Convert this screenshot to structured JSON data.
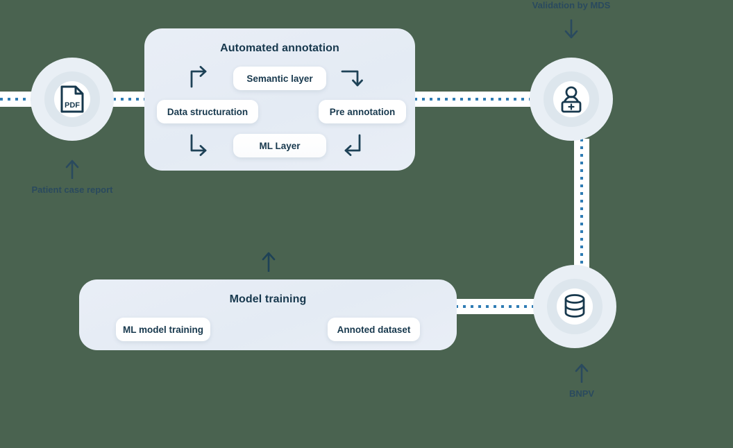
{
  "colors": {
    "background": "#4a6350",
    "card_bg": "#e8eef6",
    "node_outer": "#e9eff5",
    "node_mid": "#dde6ed",
    "node_inner": "#ffffff",
    "ink": "#17384d",
    "label_ink": "#2a4a5e",
    "dot_blue": "#2f7cb4"
  },
  "nodes": {
    "pdf": {
      "icon": "pdf-document-icon",
      "icon_text": "PDF",
      "label": "Patient case report",
      "arrow": "arrow-up-icon"
    },
    "validator": {
      "icon": "medical-professional-icon",
      "label": "Validation by MDS",
      "arrow": "arrow-down-icon"
    },
    "database": {
      "icon": "database-icon",
      "label": "BNPV",
      "arrow": "arrow-up-icon"
    }
  },
  "cards": {
    "annotation": {
      "title": "Automated annotation",
      "pills": [
        {
          "label": "Semantic layer"
        },
        {
          "label": "Data structuration"
        },
        {
          "label": "Pre annotation"
        },
        {
          "label": "ML Layer"
        }
      ],
      "arrows": [
        {
          "name": "elbow-arrow-up-right-icon"
        },
        {
          "name": "elbow-arrow-right-down-icon"
        },
        {
          "name": "elbow-arrow-down-right-icon"
        },
        {
          "name": "elbow-arrow-down-left-icon"
        }
      ]
    },
    "training": {
      "title": "Model training",
      "pills": [
        {
          "label": "ML model training"
        },
        {
          "label": "Annoted dataset"
        }
      ]
    }
  },
  "flow": {
    "arrow_up_between_cards": "arrow-up-icon"
  }
}
